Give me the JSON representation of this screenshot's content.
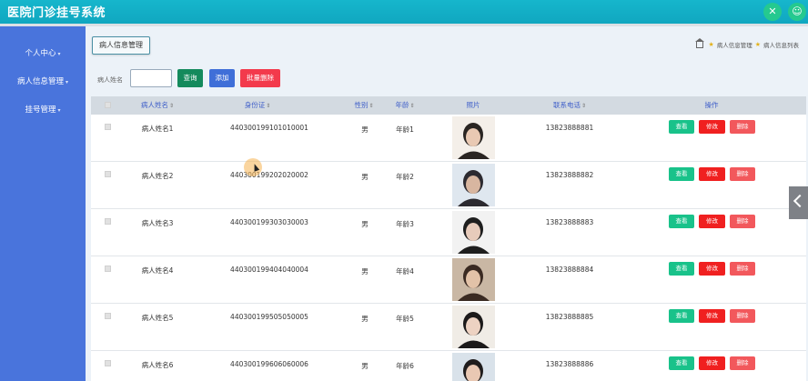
{
  "app": {
    "title": "医院门诊挂号系统"
  },
  "topbar_icons": [
    "expand-icon",
    "user-icon"
  ],
  "sidebar": {
    "items": [
      {
        "label": "个人中心"
      },
      {
        "label": "病人信息管理"
      },
      {
        "label": "挂号管理"
      }
    ]
  },
  "tab": {
    "label": "病人信息管理"
  },
  "breadcrumb": {
    "items": [
      "病人信息管理",
      "病人信息列表"
    ]
  },
  "search": {
    "label": "病人姓名",
    "value": "",
    "query_label": "查询",
    "add_label": "添加",
    "bulk_delete_label": "批量删除"
  },
  "table": {
    "headers": {
      "name": "病人姓名",
      "id": "身份证",
      "gender": "性别",
      "age": "年龄",
      "photo": "照片",
      "phone": "联系电话",
      "action": "操作"
    },
    "action_labels": {
      "view": "查看",
      "edit": "修改",
      "delete": "删除"
    },
    "rows": [
      {
        "name": "病人姓名1",
        "id": "440300199101010001",
        "gender": "男",
        "age": "年龄1",
        "phone": "13823888881"
      },
      {
        "name": "病人姓名2",
        "id": "440300199202020002",
        "gender": "男",
        "age": "年龄2",
        "phone": "13823888882"
      },
      {
        "name": "病人姓名3",
        "id": "440300199303030003",
        "gender": "男",
        "age": "年龄3",
        "phone": "13823888883"
      },
      {
        "name": "病人姓名4",
        "id": "440300199404040004",
        "gender": "男",
        "age": "年龄4",
        "phone": "13823888884"
      },
      {
        "name": "病人姓名5",
        "id": "440300199505050005",
        "gender": "男",
        "age": "年龄5",
        "phone": "13823888885"
      },
      {
        "name": "病人姓名6",
        "id": "440300199606060006",
        "gender": "男",
        "age": "年龄6",
        "phone": "13823888886"
      }
    ]
  },
  "colors": {
    "topbar": "#16b6cc",
    "sidebar": "#4974dc",
    "view": "#19c28a",
    "edit": "#f02020",
    "delete": "#f2585c"
  }
}
